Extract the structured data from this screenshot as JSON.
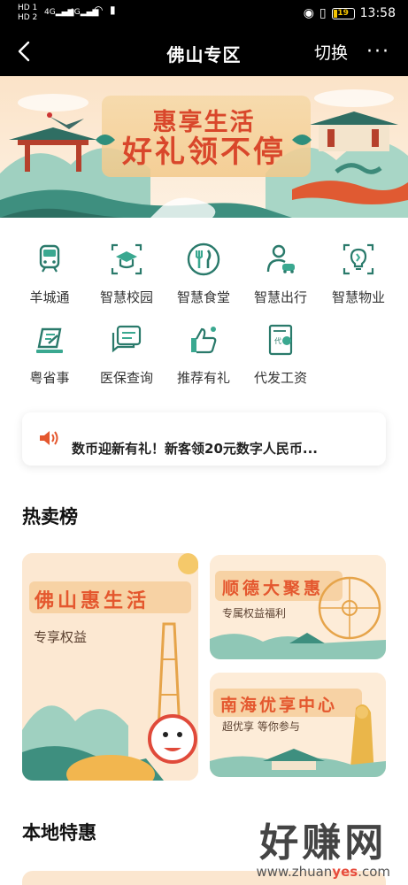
{
  "status_bar": {
    "sim1": "HD 1",
    "sim2": "HD 2",
    "signal1": "4G",
    "signal2": "4G",
    "battery": "19",
    "time": "13:58"
  },
  "nav": {
    "title": "佛山专区",
    "switch_label": "切换",
    "more_label": "···"
  },
  "banner": {
    "line1": "惠享生活",
    "line2": "好礼领不停"
  },
  "services": [
    {
      "label": "羊城通",
      "icon": "metro-icon"
    },
    {
      "label": "智慧校园",
      "icon": "graduation-cap-icon"
    },
    {
      "label": "智慧食堂",
      "icon": "fork-knife-icon"
    },
    {
      "label": "智慧出行",
      "icon": "person-car-icon"
    },
    {
      "label": "智慧物业",
      "icon": "lightbulb-icon"
    },
    {
      "label": "粤省事",
      "icon": "document-pen-icon"
    },
    {
      "label": "医保查询",
      "icon": "chat-card-icon"
    },
    {
      "label": "推荐有礼",
      "icon": "thumbs-up-icon"
    },
    {
      "label": "代发工资",
      "icon": "salary-icon"
    }
  ],
  "notice": {
    "text": "数币迎新有礼！新客领20元数字人民币..."
  },
  "hot": {
    "title": "热卖榜",
    "cards": [
      {
        "title": "佛山惠生活",
        "subtitle": "专享权益"
      },
      {
        "title": "顺德大聚惠",
        "subtitle": "专属权益福利"
      },
      {
        "title": "南海优享中心",
        "subtitle": "超优享 等你参与"
      }
    ]
  },
  "local": {
    "title": "本地特惠"
  },
  "watermark": {
    "big": "好赚网",
    "small_prefix": "www.zhuan",
    "small_highlight": "yes",
    "small_suffix": ".com"
  },
  "colors": {
    "accent_orange": "#e4572e",
    "icon_green": "#2a7a6b",
    "icon_teal": "#3aa890",
    "nav_bg": "#000000"
  }
}
